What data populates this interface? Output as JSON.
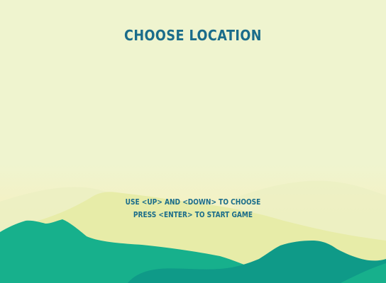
{
  "screen": {
    "title": "CHOOSE LOCATION",
    "instructions": [
      "USE <UP> AND <DOWN> TO CHOOSE",
      "PRESS <ENTER> TO START GAME"
    ]
  },
  "colors": {
    "sky": "#eff4cf",
    "haze": "#f0f1c0",
    "hill_light": "#e9eeac",
    "hill_green": "#17b08c",
    "hill_teal": "#0f9a88",
    "text": "#1a6c8a"
  }
}
